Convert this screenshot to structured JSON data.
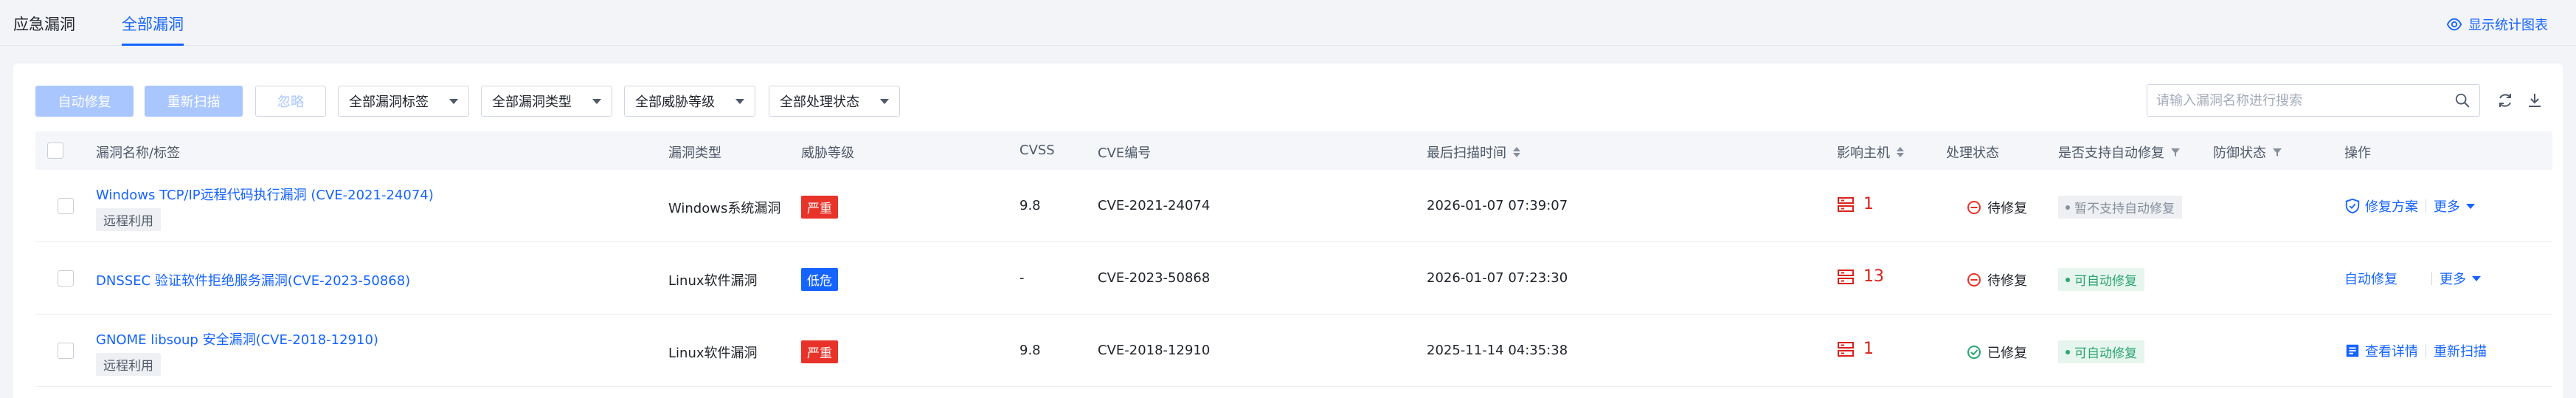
{
  "tabs": [
    {
      "label": "应急漏洞",
      "active": false
    },
    {
      "label": "全部漏洞",
      "active": true
    }
  ],
  "stats_toggle": {
    "label": "显示统计图表",
    "icon": "eye-icon"
  },
  "toolbar": {
    "auto_fix": "自动修复",
    "rescan": "重新扫描",
    "ignore": "忽略",
    "filters": [
      {
        "label": "全部漏洞标签"
      },
      {
        "label": "全部漏洞类型"
      },
      {
        "label": "全部威胁等级"
      },
      {
        "label": "全部处理状态"
      }
    ],
    "search_placeholder": "请输入漏洞名称进行搜索",
    "refresh_icon": "refresh-icon",
    "download_icon": "download-icon"
  },
  "table": {
    "columns": {
      "name": "漏洞名称/标签",
      "type": "漏洞类型",
      "severity": "威胁等级",
      "cvss": "CVSS",
      "cve": "CVE编号",
      "last_scan": "最后扫描时间",
      "hosts": "影响主机",
      "status": "处理状态",
      "auto_fix": "是否支持自动修复",
      "defense": "防御状态",
      "actions": "操作"
    },
    "rows": [
      {
        "name": "Windows TCP/IP远程代码执行漏洞 (CVE-2021-24074)",
        "tag": "远程利用",
        "type": "Windows系统漏洞",
        "severity": "严重",
        "severity_color": "#e8332a",
        "cvss": "9.8",
        "cve": "CVE-2021-24074",
        "last_scan": "2026-01-07 07:39:07",
        "hosts": "1",
        "status": "待修复",
        "status_kind": "pending",
        "auto_fix": "暂不支持自动修复",
        "auto_fix_kind": "no",
        "action_primary": "修复方案",
        "action_primary_icon": "shield-icon",
        "action_more": "更多"
      },
      {
        "name": "DNSSEC 验证软件拒绝服务漏洞(CVE-2023-50868)",
        "tag": "",
        "type": "Linux软件漏洞",
        "severity": "低危",
        "severity_color": "#1664ff",
        "cvss": "-",
        "cve": "CVE-2023-50868",
        "last_scan": "2026-01-07 07:23:30",
        "hosts": "13",
        "status": "待修复",
        "status_kind": "pending",
        "auto_fix": "可自动修复",
        "auto_fix_kind": "yes",
        "action_primary": "自动修复",
        "action_primary_icon": "",
        "action_more": "更多"
      },
      {
        "name": "GNOME libsoup 安全漏洞(CVE-2018-12910)",
        "tag": "远程利用",
        "type": "Linux软件漏洞",
        "severity": "严重",
        "severity_color": "#e8332a",
        "cvss": "9.8",
        "cve": "CVE-2018-12910",
        "last_scan": "2025-11-14 04:35:38",
        "hosts": "1",
        "status": "已修复",
        "status_kind": "fixed",
        "auto_fix": "可自动修复",
        "auto_fix_kind": "yes",
        "action_primary": "查看详情",
        "action_primary_icon": "detail-icon",
        "action_more": "重新扫描"
      }
    ]
  },
  "colors": {
    "accent": "#1664ff",
    "danger": "#e8332a",
    "success": "#2ba471"
  }
}
